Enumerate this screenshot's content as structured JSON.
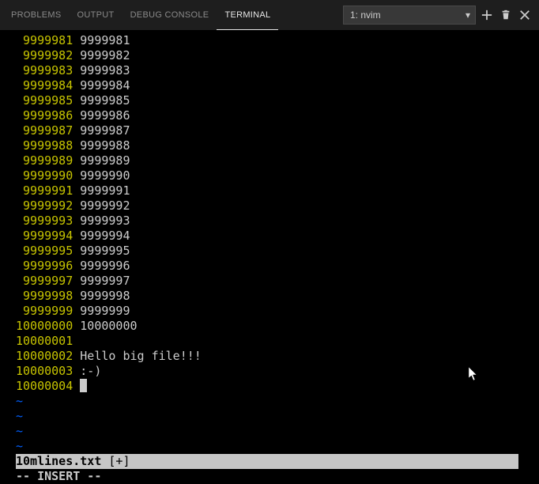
{
  "header": {
    "tabs": [
      {
        "label": "PROBLEMS",
        "active": false
      },
      {
        "label": "OUTPUT",
        "active": false
      },
      {
        "label": "DEBUG CONSOLE",
        "active": false
      },
      {
        "label": "TERMINAL",
        "active": true
      }
    ],
    "terminal_select": "1: nvim"
  },
  "terminal": {
    "lines": [
      {
        "lineno": " 9999981",
        "text": " 9999981"
      },
      {
        "lineno": " 9999982",
        "text": " 9999982"
      },
      {
        "lineno": " 9999983",
        "text": " 9999983"
      },
      {
        "lineno": " 9999984",
        "text": " 9999984"
      },
      {
        "lineno": " 9999985",
        "text": " 9999985"
      },
      {
        "lineno": " 9999986",
        "text": " 9999986"
      },
      {
        "lineno": " 9999987",
        "text": " 9999987"
      },
      {
        "lineno": " 9999988",
        "text": " 9999988"
      },
      {
        "lineno": " 9999989",
        "text": " 9999989"
      },
      {
        "lineno": " 9999990",
        "text": " 9999990"
      },
      {
        "lineno": " 9999991",
        "text": " 9999991"
      },
      {
        "lineno": " 9999992",
        "text": " 9999992"
      },
      {
        "lineno": " 9999993",
        "text": " 9999993"
      },
      {
        "lineno": " 9999994",
        "text": " 9999994"
      },
      {
        "lineno": " 9999995",
        "text": " 9999995"
      },
      {
        "lineno": " 9999996",
        "text": " 9999996"
      },
      {
        "lineno": " 9999997",
        "text": " 9999997"
      },
      {
        "lineno": " 9999998",
        "text": " 9999998"
      },
      {
        "lineno": " 9999999",
        "text": " 9999999"
      },
      {
        "lineno": "10000000",
        "text": " 10000000"
      },
      {
        "lineno": "10000001",
        "text": ""
      },
      {
        "lineno": "10000002",
        "text": " Hello big file!!!"
      },
      {
        "lineno": "10000003",
        "text": " :-)"
      }
    ],
    "cursor_line": {
      "lineno": "10000004",
      "text": " "
    },
    "tildes": [
      "~",
      "~",
      "~",
      "~"
    ],
    "status": {
      "filename": "10mlines.txt",
      "modified": " [+]"
    },
    "mode": "-- INSERT --"
  }
}
